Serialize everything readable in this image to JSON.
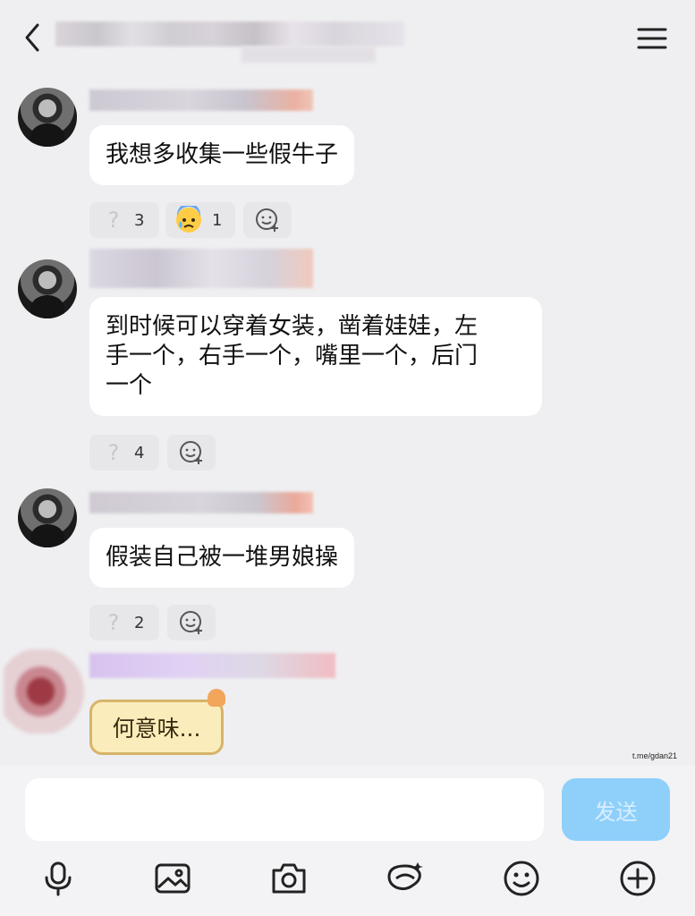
{
  "messages": [
    {
      "text": "我想多收集一些假牛子",
      "reactions": [
        {
          "icon": "question-icon",
          "count": "3"
        },
        {
          "icon": "anxious-sweat-emoji",
          "count": "1"
        }
      ]
    },
    {
      "text_lines": [
        "到时候可以穿着女装，凿着娃娃，左",
        "手一个，右手一个，嘴里一个，后门",
        "一个"
      ],
      "reactions": [
        {
          "icon": "question-icon",
          "count": "4"
        }
      ]
    },
    {
      "text": "假装自己被一堆男娘操",
      "reactions": [
        {
          "icon": "question-icon",
          "count": "2"
        }
      ]
    }
  ],
  "sticker": {
    "text": "何意味..."
  },
  "watermark": "t.me/gdan21",
  "input": {
    "value": "",
    "placeholder": ""
  },
  "send_button": {
    "label": "发送"
  },
  "toolbar": [
    "microphone-icon",
    "image-icon",
    "camera-icon",
    "sticker-icon",
    "emoji-icon",
    "plus-icon"
  ],
  "colors": {
    "background": "#efeff1",
    "bubble": "#ffffff",
    "send_button": "#8fd0fb",
    "sticker_bg": "#fbedbb"
  }
}
